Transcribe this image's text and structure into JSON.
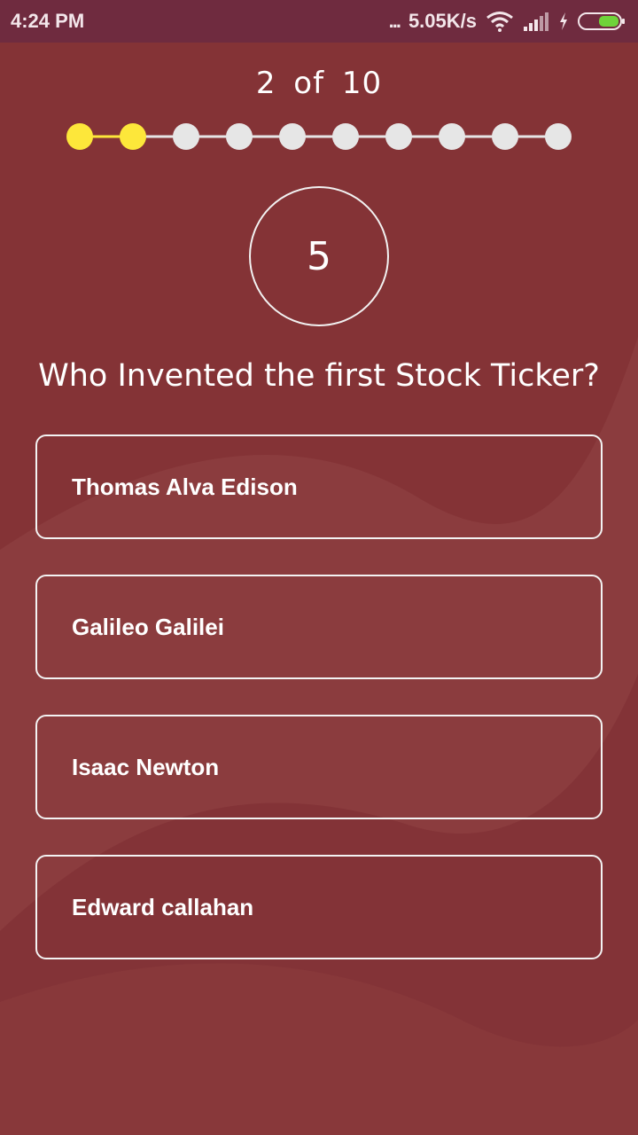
{
  "status_bar": {
    "time": "4:24 PM",
    "signal_dots": "...",
    "net_speed": "5.05K/s",
    "icons": [
      "wifi-icon",
      "signal-icon",
      "charging-icon",
      "battery-icon"
    ]
  },
  "quiz": {
    "counter": "2  of  10",
    "progress": {
      "current": 2,
      "total": 10
    },
    "timer": "5",
    "question": "Who Invented the first Stock Ticker?",
    "options": [
      {
        "label": "Thomas Alva Edison"
      },
      {
        "label": "Galileo Galilei"
      },
      {
        "label": "Isaac Newton"
      },
      {
        "label": "Edward callahan"
      }
    ]
  },
  "colors": {
    "background": "#843336",
    "status_bar": "#6f2b3f",
    "progress_active": "#fde73a",
    "progress_inactive": "#e6e6e6",
    "battery": "#6fd33a"
  }
}
